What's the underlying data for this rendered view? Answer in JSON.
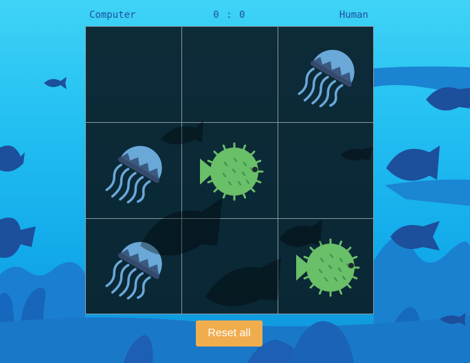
{
  "scoreboard": {
    "player_left": "Computer",
    "score": "0 : 0",
    "player_right": "Human"
  },
  "board": {
    "cells": [
      "",
      "",
      "jellyfish",
      "jellyfish",
      "pufferfish",
      "",
      "jellyfish",
      "",
      "pufferfish"
    ]
  },
  "controls": {
    "reset_label": "Reset all"
  },
  "colors": {
    "reset_button": "#f0ad4e",
    "jellyfish": "#6aa8d8",
    "pufferfish": "#6abf69",
    "board_bg": "#0b1e28"
  }
}
